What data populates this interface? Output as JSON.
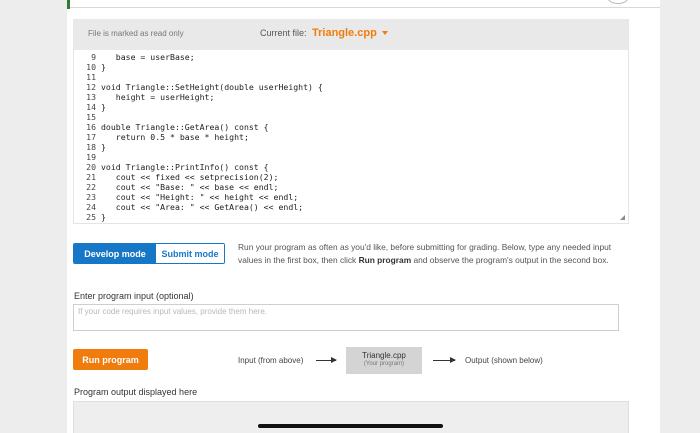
{
  "editor": {
    "readonly_label": "File is marked as read only",
    "current_file_label": "Current file:",
    "current_file_name": "Triangle.cpp",
    "code_lines": [
      {
        "num": "9",
        "code": "   base = userBase;"
      },
      {
        "num": "10",
        "code": "}"
      },
      {
        "num": "11",
        "code": ""
      },
      {
        "num": "12",
        "code": "void Triangle::SetHeight(double userHeight) {"
      },
      {
        "num": "13",
        "code": "   height = userHeight;"
      },
      {
        "num": "14",
        "code": "}"
      },
      {
        "num": "15",
        "code": ""
      },
      {
        "num": "16",
        "code": "double Triangle::GetArea() const {"
      },
      {
        "num": "17",
        "code": "   return 0.5 * base * height;"
      },
      {
        "num": "18",
        "code": "}"
      },
      {
        "num": "19",
        "code": ""
      },
      {
        "num": "20",
        "code": "void Triangle::PrintInfo() const {"
      },
      {
        "num": "21",
        "code": "   cout << fixed << setprecision(2);"
      },
      {
        "num": "22",
        "code": "   cout << \"Base: \" << base << endl;"
      },
      {
        "num": "23",
        "code": "   cout << \"Height: \" << height << endl;"
      },
      {
        "num": "24",
        "code": "   cout << \"Area: \" << GetArea() << endl;"
      },
      {
        "num": "25",
        "code": "}"
      }
    ]
  },
  "modes": {
    "develop_label": "Develop mode",
    "submit_label": "Submit mode",
    "active": "develop"
  },
  "instructions": {
    "part1": "Run your program as often as you'd like, before submitting for grading. Below, type any needed input values in the first box, then click ",
    "bold": "Run program",
    "part2": " and observe the program's output in the second box."
  },
  "input": {
    "label": "Enter program input (optional)",
    "placeholder": "If your code requires input values, provide them here.",
    "value": ""
  },
  "run": {
    "button_label": "Run program",
    "flow_input": "Input (from above)",
    "program_name": "Triangle.cpp",
    "program_sub": "(Your program)",
    "flow_output": "Output (shown below)"
  },
  "output": {
    "label": "Program output displayed here"
  },
  "colors": {
    "accent_orange": "#f07c0d",
    "accent_blue": "#1777c7"
  }
}
